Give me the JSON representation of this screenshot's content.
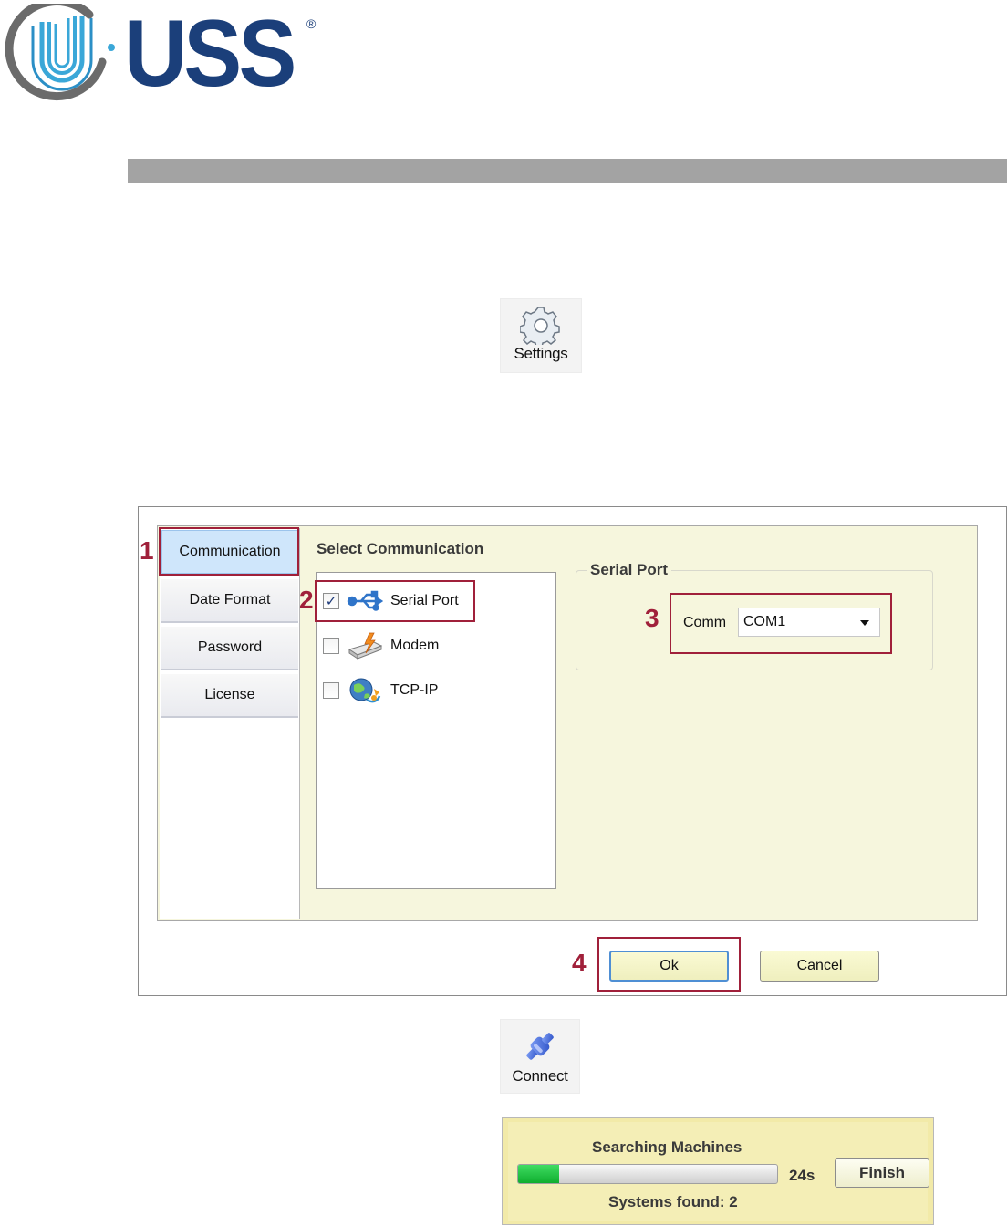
{
  "logo": {
    "wordmark": "USS",
    "registered": "®"
  },
  "toolbar": {
    "settings_label": "Settings",
    "connect_label": "Connect"
  },
  "dialog": {
    "tabs": [
      {
        "label": "Communication",
        "active": true
      },
      {
        "label": "Date Format",
        "active": false
      },
      {
        "label": "Password",
        "active": false
      },
      {
        "label": "License",
        "active": false
      }
    ],
    "select_title": "Select Communication",
    "options": [
      {
        "label": "Serial Port",
        "checked": true,
        "icon": "usb-icon"
      },
      {
        "label": "Modem",
        "checked": false,
        "icon": "modem-icon"
      },
      {
        "label": "TCP-IP",
        "checked": false,
        "icon": "network-globe-icon"
      }
    ],
    "serial_group_title": "Serial Port",
    "comm_label": "Comm",
    "comm_value": "COM1",
    "ok_label": "Ok",
    "cancel_label": "Cancel"
  },
  "annotations": [
    "1",
    "2",
    "3",
    "4"
  ],
  "search": {
    "title": "Searching Machines",
    "progress": 0.16,
    "time": "24s",
    "finish_label": "Finish",
    "found_text": "Systems found:  2"
  },
  "colors": {
    "brand": "#1b3f7a",
    "annotation": "#a0203a",
    "panel": "#f6f6dd",
    "progress": "#1fc040"
  }
}
